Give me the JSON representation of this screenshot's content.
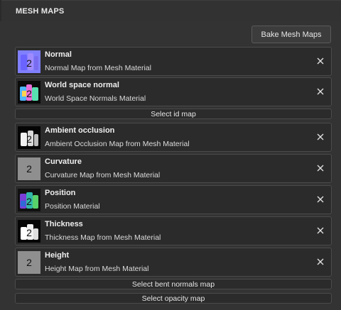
{
  "panel": {
    "tab_title": "MESH MAPS",
    "bake_label": "Bake Mesh Maps"
  },
  "maps": [
    {
      "title": "Normal",
      "subtitle": "Normal Map from Mesh Material",
      "icon": "normal-thumbnail"
    },
    {
      "title": "World space normal",
      "subtitle": "World Space Normals Material",
      "icon": "world-space-normal-thumbnail"
    },
    {
      "title": "Ambient occlusion",
      "subtitle": "Ambient Occlusion Map from Mesh Material",
      "icon": "ambient-occlusion-thumbnail"
    },
    {
      "title": "Curvature",
      "subtitle": "Curvature Map from Mesh Material",
      "icon": "curvature-thumbnail"
    },
    {
      "title": "Position",
      "subtitle": "Position Material",
      "icon": "position-thumbnail"
    },
    {
      "title": "Thickness",
      "subtitle": "Thickness Map from Mesh Material",
      "icon": "thickness-thumbnail"
    },
    {
      "title": "Height",
      "subtitle": "Height Map from Mesh Material",
      "icon": "height-thumbnail"
    }
  ],
  "select_buttons": {
    "id_map": "Select id map",
    "bent_normals": "Select bent normals map",
    "opacity": "Select opacity map"
  },
  "thumb_digit": "2",
  "colors": {
    "background": "#333333",
    "row_background": "#2b2b2b",
    "border": "#4b4b4b",
    "text": "#e6e6e6"
  }
}
